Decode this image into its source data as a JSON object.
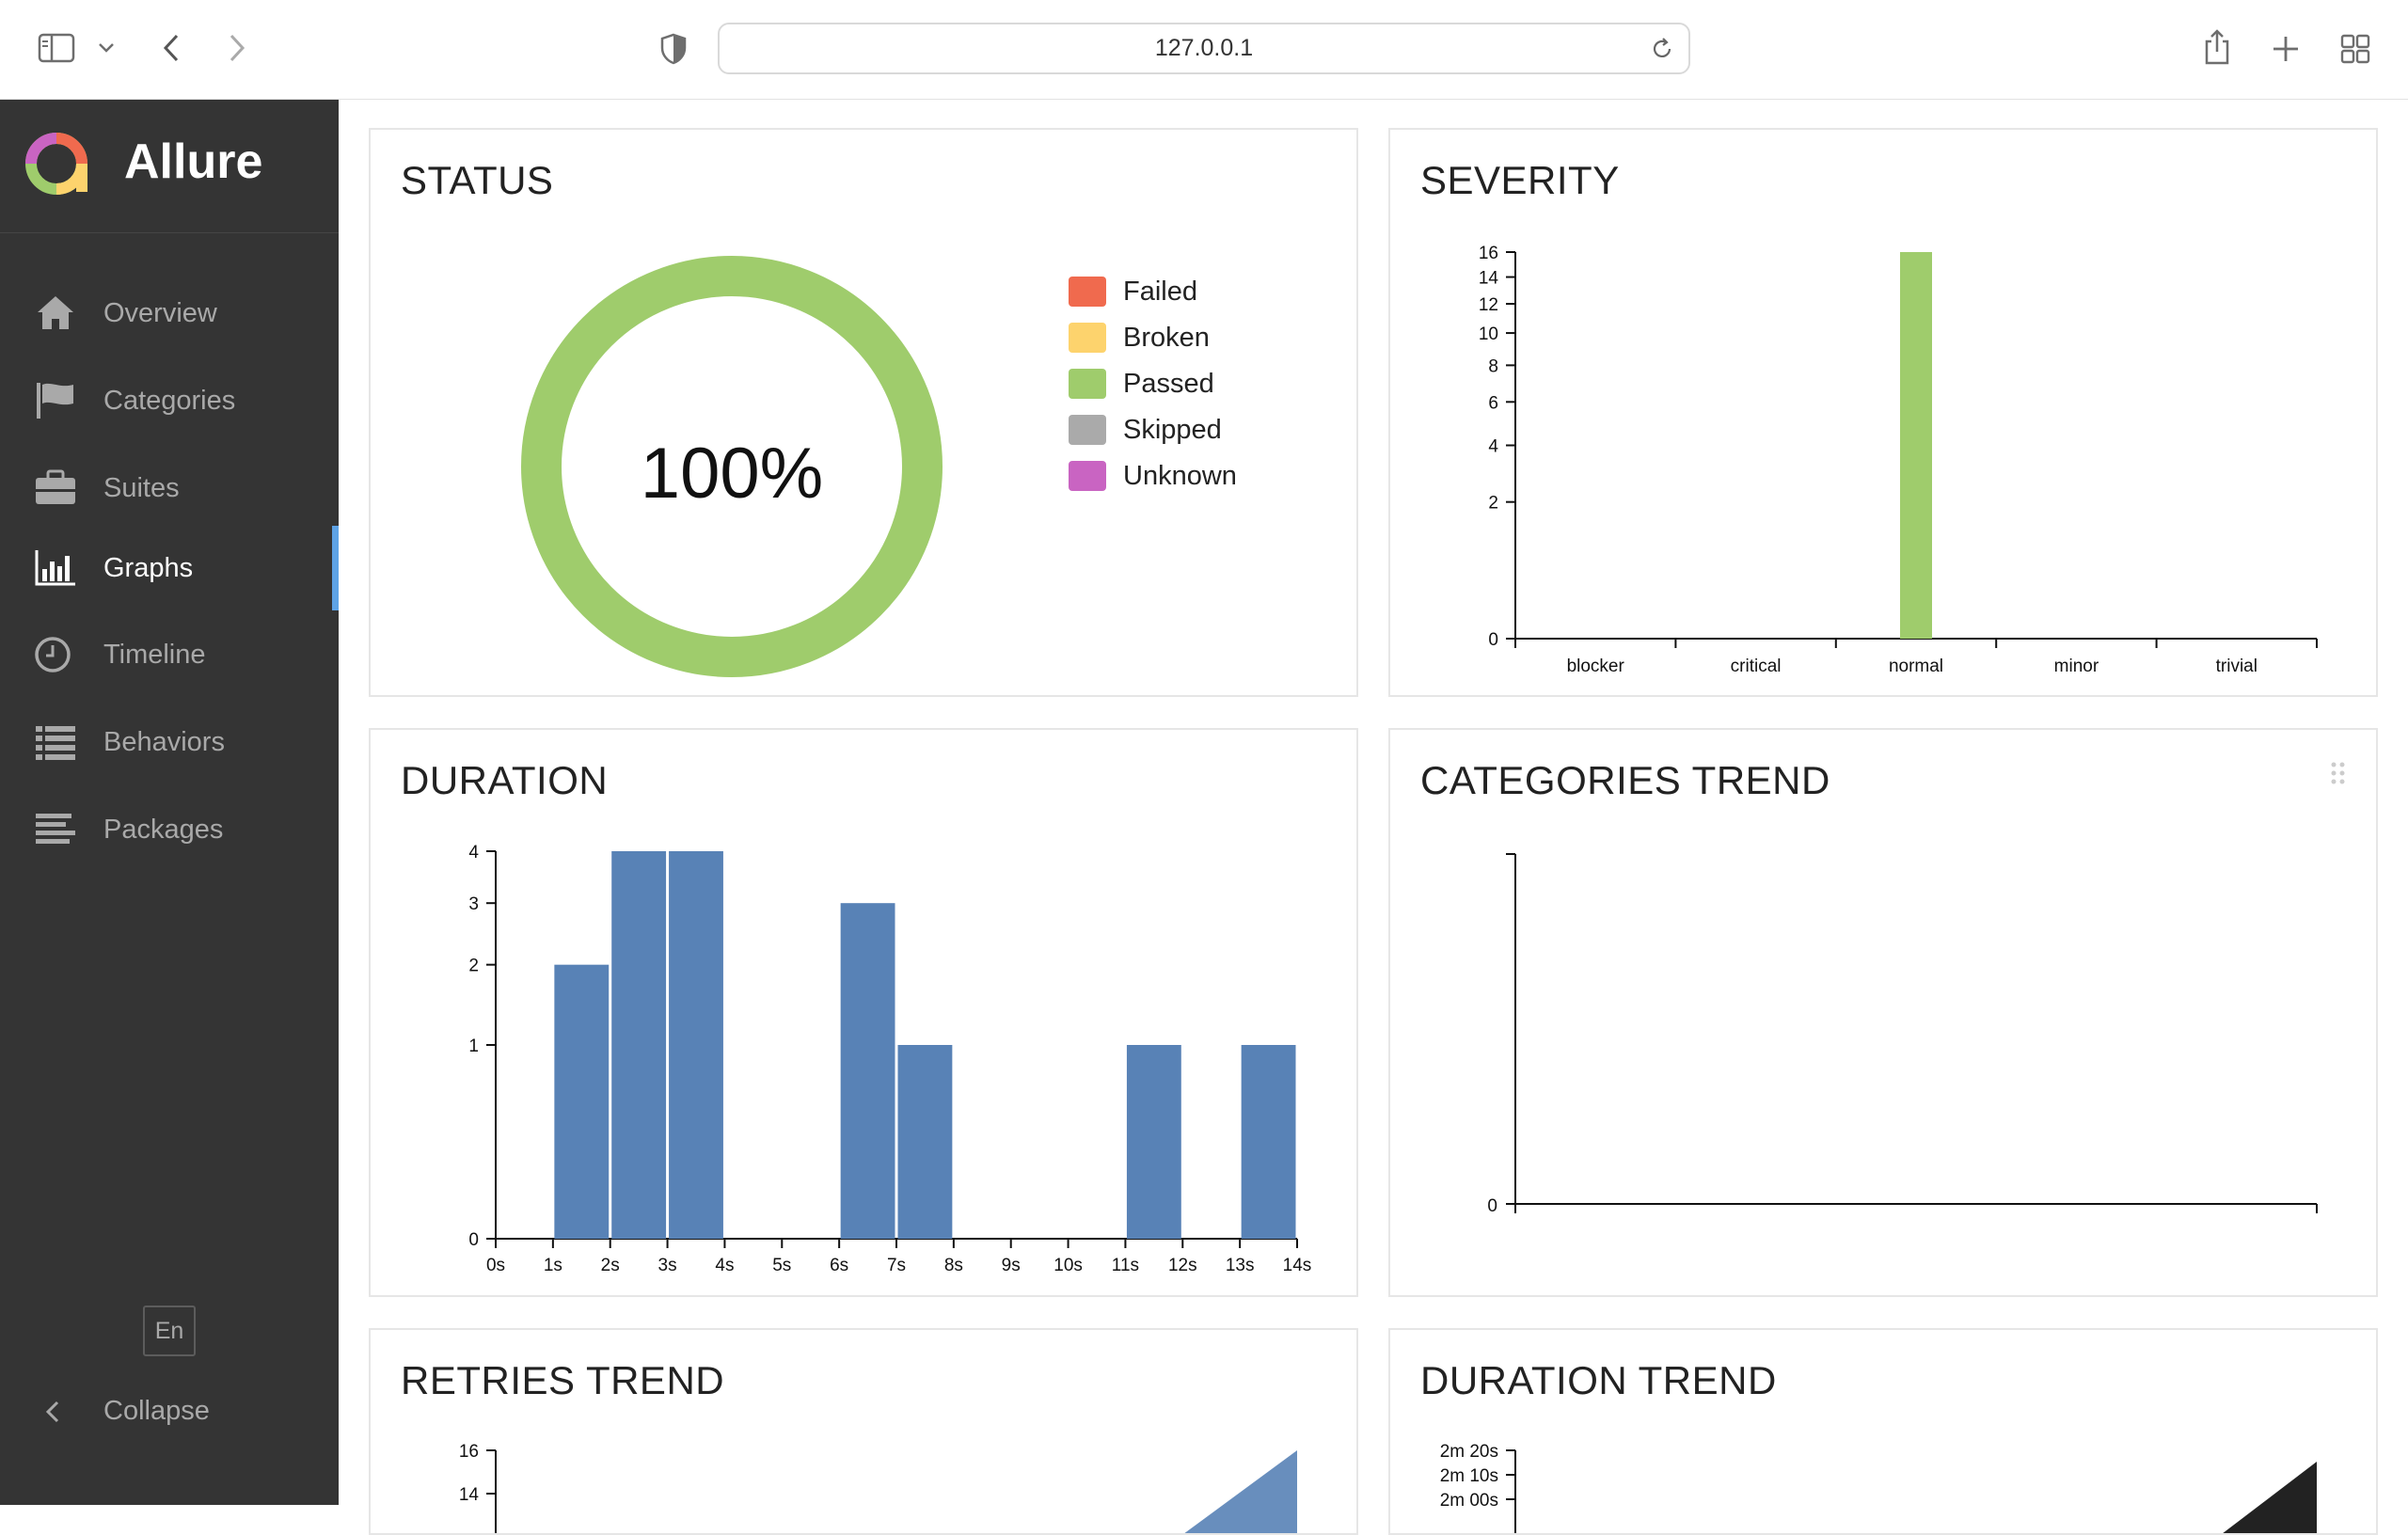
{
  "browser": {
    "url": "127.0.0.1",
    "icons": [
      "sidebar-toggle-icon",
      "chevron-down-icon",
      "back-icon",
      "forward-icon",
      "shield-icon",
      "reload-icon",
      "share-icon",
      "new-tab-icon",
      "tab-overview-icon"
    ]
  },
  "app": {
    "name": "Allure",
    "nav": [
      {
        "label": "Overview",
        "icon": "home-icon"
      },
      {
        "label": "Categories",
        "icon": "flag-icon"
      },
      {
        "label": "Suites",
        "icon": "briefcase-icon"
      },
      {
        "label": "Graphs",
        "icon": "bar-chart-icon",
        "active": true
      },
      {
        "label": "Timeline",
        "icon": "clock-icon"
      },
      {
        "label": "Behaviors",
        "icon": "list-icon"
      },
      {
        "label": "Packages",
        "icon": "align-left-icon"
      }
    ],
    "language": "En",
    "collapse_label": "Collapse",
    "active_color": "#5ea3e6"
  },
  "widgets": {
    "status": {
      "title": "STATUS",
      "percent_label": "100%",
      "legend": [
        {
          "label": "Failed",
          "color": "#f06a4e"
        },
        {
          "label": "Broken",
          "color": "#fdd36d"
        },
        {
          "label": "Passed",
          "color": "#9fcc6c"
        },
        {
          "label": "Skipped",
          "color": "#aaaaaa"
        },
        {
          "label": "Unknown",
          "color": "#c964c2"
        }
      ]
    },
    "severity": {
      "title": "SEVERITY"
    },
    "duration": {
      "title": "DURATION"
    },
    "categories_trend": {
      "title": "CATEGORIES TREND",
      "y_tick": "0"
    },
    "retries_trend": {
      "title": "RETRIES TREND"
    },
    "duration_trend": {
      "title": "DURATION TREND"
    }
  },
  "chart_data": [
    {
      "id": "status",
      "type": "pie",
      "slices": [
        {
          "name": "Failed",
          "value": 0,
          "color": "#f06a4e"
        },
        {
          "name": "Broken",
          "value": 0,
          "color": "#fdd36d"
        },
        {
          "name": "Passed",
          "value": 16,
          "color": "#9fcc6c"
        },
        {
          "name": "Skipped",
          "value": 0,
          "color": "#aaaaaa"
        },
        {
          "name": "Unknown",
          "value": 0,
          "color": "#c964c2"
        }
      ],
      "center_label": "100%"
    },
    {
      "id": "severity",
      "type": "bar",
      "categories": [
        "blocker",
        "critical",
        "normal",
        "minor",
        "trivial"
      ],
      "values": [
        0,
        0,
        16,
        0,
        0
      ],
      "yticks": [
        0,
        2,
        4,
        6,
        8,
        10,
        12,
        14,
        16
      ],
      "ylim": [
        0,
        16
      ],
      "color": "#9fcc6c"
    },
    {
      "id": "duration",
      "type": "bar",
      "x_ticks": [
        "0s",
        "1s",
        "2s",
        "3s",
        "4s",
        "5s",
        "6s",
        "7s",
        "8s",
        "9s",
        "10s",
        "11s",
        "12s",
        "13s",
        "14s"
      ],
      "bins": [
        {
          "from": 1,
          "to": 2,
          "value": 2
        },
        {
          "from": 2,
          "to": 3,
          "value": 4
        },
        {
          "from": 3,
          "to": 4,
          "value": 4
        },
        {
          "from": 6,
          "to": 7,
          "value": 3
        },
        {
          "from": 7,
          "to": 8,
          "value": 1
        },
        {
          "from": 11,
          "to": 12,
          "value": 1
        },
        {
          "from": 13,
          "to": 14,
          "value": 1
        }
      ],
      "yticks": [
        0,
        1,
        2,
        3,
        4
      ],
      "ylim": [
        0,
        4
      ],
      "color": "#5882b6"
    },
    {
      "id": "retries_trend",
      "type": "area",
      "yticks": [
        14,
        16
      ],
      "color": "#5882b6"
    },
    {
      "id": "duration_trend",
      "type": "area",
      "yticks": [
        "2m 00s",
        "2m 10s",
        "2m 20s"
      ],
      "color": "#222222"
    }
  ]
}
